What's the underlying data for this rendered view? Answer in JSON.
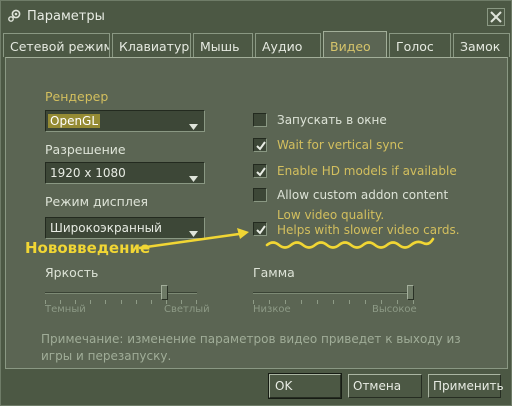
{
  "window": {
    "title": "Параметры",
    "icon": "steam-icon",
    "close_icon": "close-icon"
  },
  "tabs": [
    {
      "label": "Сетевой режим"
    },
    {
      "label": "Клавиатура"
    },
    {
      "label": "Мышь"
    },
    {
      "label": "Аудио"
    },
    {
      "label": "Видео",
      "active": true
    },
    {
      "label": "Голос"
    },
    {
      "label": "Замок"
    }
  ],
  "video": {
    "renderer": {
      "label": "Рендерер",
      "value": "OpenGL"
    },
    "resolution": {
      "label": "Разрешение",
      "value": "1920 x 1080"
    },
    "display_mode": {
      "label": "Режим дисплея",
      "value": "Широкоэкранный"
    },
    "checkboxes": [
      {
        "label": "Запускать в окне",
        "checked": false
      },
      {
        "label": "Wait for vertical sync",
        "checked": true
      },
      {
        "label": "Enable HD models if available",
        "checked": true
      },
      {
        "label": "Allow custom addon content",
        "checked": false
      },
      {
        "label_line1": "Low video quality.",
        "label_line2": "Helps with slower video cards.",
        "checked": true
      }
    ],
    "brightness": {
      "label": "Яркость",
      "min_label": "Темный",
      "max_label": "Светлый",
      "level": 0.8
    },
    "gamma": {
      "label": "Гамма",
      "min_label": "Низкое",
      "max_label": "Высокое",
      "level": 1.0
    },
    "note": "Примечание: изменение параметров видео приведет к выходу из игры и перезапуску."
  },
  "annotation": {
    "text": "Нововведение",
    "color": "#f1d634"
  },
  "buttons": {
    "ok": "OK",
    "cancel": "Отмена",
    "apply": "Применить"
  },
  "colors": {
    "accent": "#d3bf5e",
    "panel": "#5b6553",
    "background": "#4c5844"
  }
}
